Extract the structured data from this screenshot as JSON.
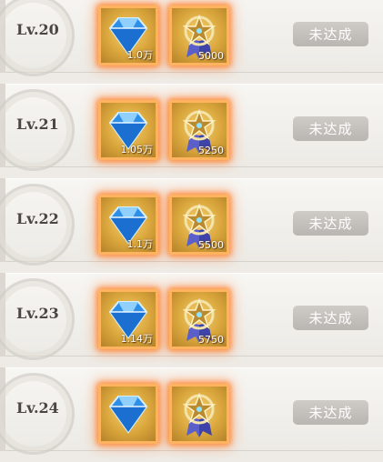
{
  "rows": [
    {
      "level": "Lv.20",
      "gem_qty": "1.0万",
      "medal_qty": "5000",
      "status": "未达成"
    },
    {
      "level": "Lv.21",
      "gem_qty": "1.05万",
      "medal_qty": "5250",
      "status": "未达成"
    },
    {
      "level": "Lv.22",
      "gem_qty": "1.1万",
      "medal_qty": "5500",
      "status": "未达成"
    },
    {
      "level": "Lv.23",
      "gem_qty": "1.14万",
      "medal_qty": "5750",
      "status": "未达成"
    },
    {
      "level": "Lv.24",
      "gem_qty": "",
      "medal_qty": "",
      "status": "未达成"
    }
  ],
  "icons": {
    "reward_1": "blue-diamond-icon",
    "reward_2": "star-medal-icon"
  },
  "colors": {
    "reward_glow": "#ff8c3c",
    "status_disabled": "#c4c0bc"
  }
}
